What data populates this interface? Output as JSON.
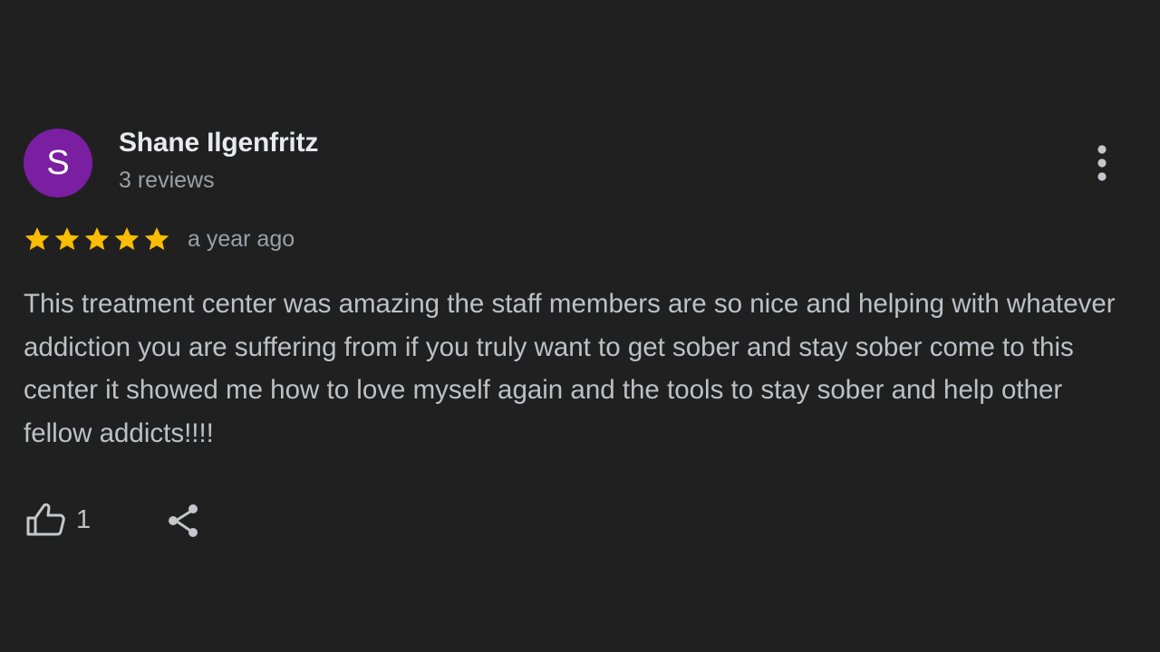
{
  "review": {
    "author": {
      "initial": "S",
      "name": "Shane Ilgenfritz",
      "review_count": "3 reviews",
      "avatar_color": "#7b1fa2"
    },
    "rating": {
      "stars": 5,
      "max_stars": 5,
      "star_color": "#fbbc04",
      "icon": "star-icon"
    },
    "date": "a year ago",
    "text": "This treatment center was amazing the staff members are so nice and helping with whatever addiction you are suffering from if you truly want to get sober and stay sober come to this center it showed me how to love myself again and the tools to stay sober and help other fellow addicts!!!!",
    "actions": {
      "like_icon": "thumbs-up-icon",
      "like_count": "1",
      "share_icon": "share-icon",
      "more_icon": "more-vert-icon"
    }
  },
  "theme": {
    "background": "#202020",
    "primary_text": "#e8eaed",
    "secondary_text": "#9aa0a6",
    "body_text": "#bdc1c6"
  }
}
